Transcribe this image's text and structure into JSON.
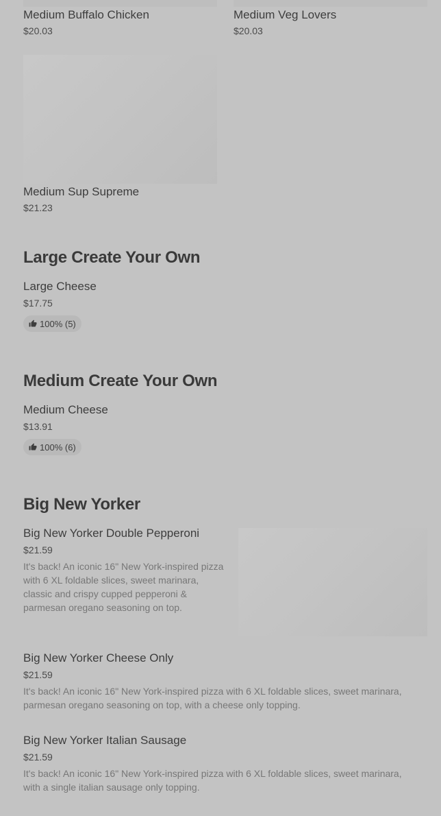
{
  "top_grid": [
    {
      "name": "Medium Buffalo Chicken",
      "price": "$20.03"
    },
    {
      "name": "Medium Veg Lovers",
      "price": "$20.03"
    },
    {
      "name": "Medium Sup Supreme",
      "price": "$21.23"
    }
  ],
  "sections": [
    {
      "title": "Large Create Your Own",
      "items": [
        {
          "name": "Large Cheese",
          "price": "$17.75",
          "rating": "100% (5)"
        }
      ]
    },
    {
      "title": "Medium Create Your Own",
      "items": [
        {
          "name": "Medium Cheese",
          "price": "$13.91",
          "rating": "100% (6)"
        }
      ]
    },
    {
      "title": "Big New Yorker",
      "items": [
        {
          "name": "Big New Yorker Double Pepperoni",
          "price": "$21.59",
          "description": "It's back! An iconic 16\" New York-inspired pizza with 6 XL foldable slices, sweet marinara, classic and crispy cupped pepperoni & parmesan oregano seasoning on top."
        },
        {
          "name": "Big New Yorker Cheese Only",
          "price": "$21.59",
          "description": "It's back! An iconic 16\" New York-inspired pizza with 6 XL foldable slices, sweet marinara, parmesan oregano seasoning on top, with a cheese only topping."
        },
        {
          "name": "Big New Yorker Italian Sausage",
          "price": "$21.59",
          "description": "It's back! An iconic 16\" New York-inspired pizza with 6 XL foldable slices, sweet marinara, with a single italian sausage only topping."
        }
      ]
    }
  ],
  "icons": {
    "rating": "thumbs-up-icon"
  }
}
